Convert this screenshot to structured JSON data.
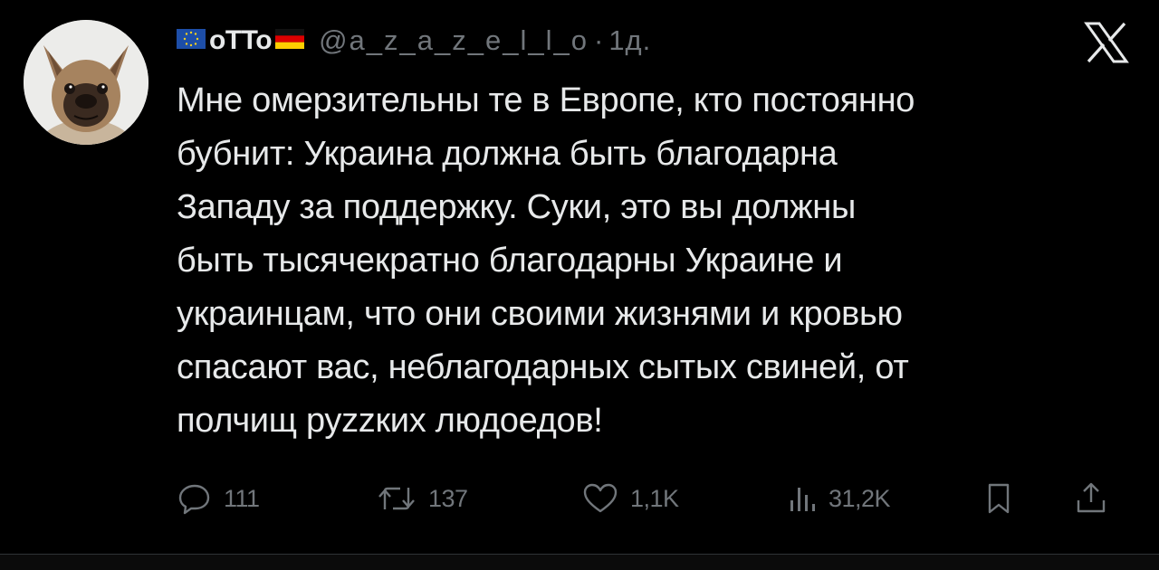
{
  "author": {
    "display_name": "oTTo",
    "handle": "@a_z_a_z_e_l_l_o",
    "separator": "·",
    "time": "1д.",
    "flags": [
      "eu-flag-icon",
      "germany-flag-icon"
    ]
  },
  "tweet": {
    "lines": [
      "Мне омерзительны те в Европе, кто постоянно",
      "бубнит:  Украина должна быть благодарна",
      "Западу за поддержку. Суки, это вы должны",
      "быть тысячекратно благодарны Украине и",
      "украинцам, что они своими жизнями и кровью",
      "спасают вас, неблагодарных сытых свиней, от",
      "полчищ руzzких людоедов!"
    ]
  },
  "actions": {
    "reply_count": "111",
    "retweet_count": "137",
    "like_count": "1,1K",
    "views_count": "31,2K"
  },
  "icons": {
    "brand": "x-logo-icon",
    "reply": "reply-icon",
    "retweet": "retweet-icon",
    "like": "heart-icon",
    "views": "views-icon",
    "bookmark": "bookmark-icon",
    "share": "share-icon"
  },
  "colors": {
    "background": "#000000",
    "text": "#e7e9ea",
    "secondary": "#71767b"
  }
}
